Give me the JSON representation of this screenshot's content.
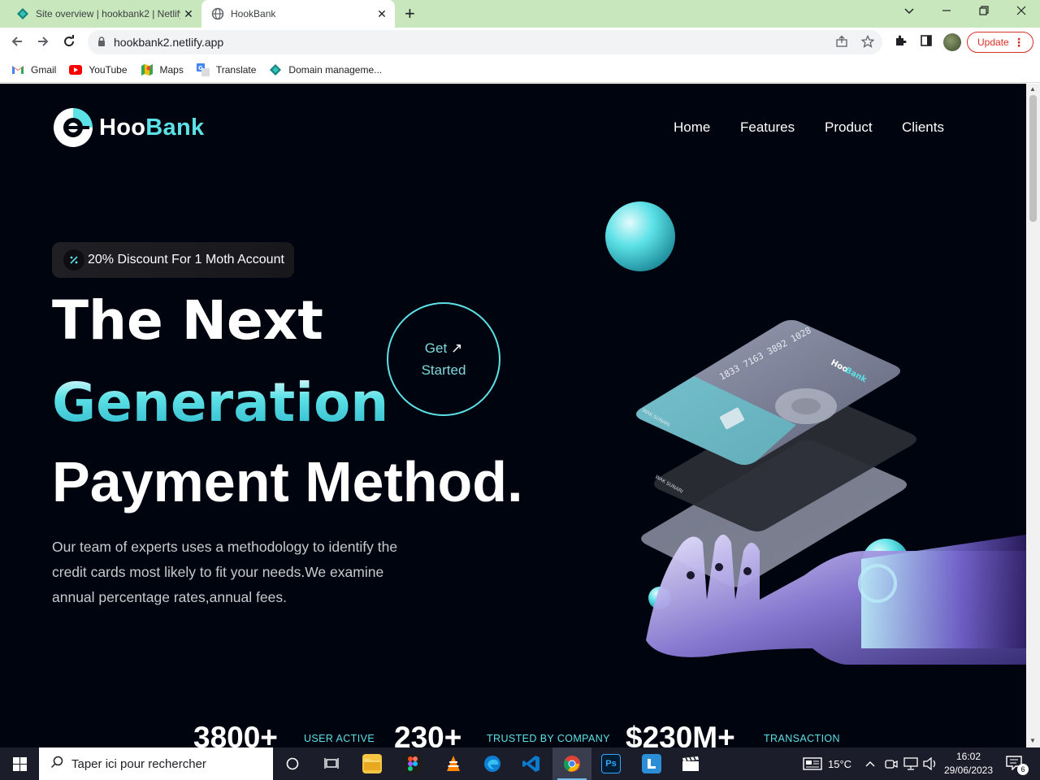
{
  "browser": {
    "tabs": [
      {
        "title": "Site overview | hookbank2 | Netlify",
        "close": "✕"
      },
      {
        "title": "HookBank",
        "close": "✕"
      }
    ],
    "new_tab": "+",
    "url": "hookbank2.netlify.app",
    "update_label": "Update",
    "bookmarks": [
      "Gmail",
      "YouTube",
      "Maps",
      "Translate",
      "Domain manageme..."
    ]
  },
  "site": {
    "logo": {
      "part1": "Hoo",
      "part2": "Bank"
    },
    "nav": [
      "Home",
      "Features",
      "Product",
      "Clients"
    ],
    "badge": {
      "prefix": "20%",
      "text": "Discount For 1 Moth Account"
    },
    "headline": {
      "line1": "The Next",
      "line2": "Generation",
      "line3": "Payment Method."
    },
    "cta": {
      "line1": "Get",
      "line2": "Started",
      "arrow": "↗"
    },
    "description": "Our team of experts uses a methodology to identify the credit cards most likely to fit your needs.We examine annual percentage rates,annual fees.",
    "card": {
      "number": "1833 7163 3892 1028",
      "holder": "WAK SUNARI",
      "brand_part1": "Hoo",
      "brand_part2": "Bank"
    },
    "stats": [
      {
        "value": "3800+",
        "label": "USER ACTIVE"
      },
      {
        "value": "230+",
        "label": "TRUSTED BY COMPANY"
      },
      {
        "value": "$230M+",
        "label": "TRANSACTION"
      }
    ]
  },
  "taskbar": {
    "search_placeholder": "Taper ici pour rechercher",
    "weather": "15°C",
    "time": "16:02",
    "date": "29/06/2023",
    "notifications": "6"
  },
  "colors": {
    "accent": "#5ce1e6",
    "background": "#00040f",
    "tabbar": "#c9e7bd"
  }
}
